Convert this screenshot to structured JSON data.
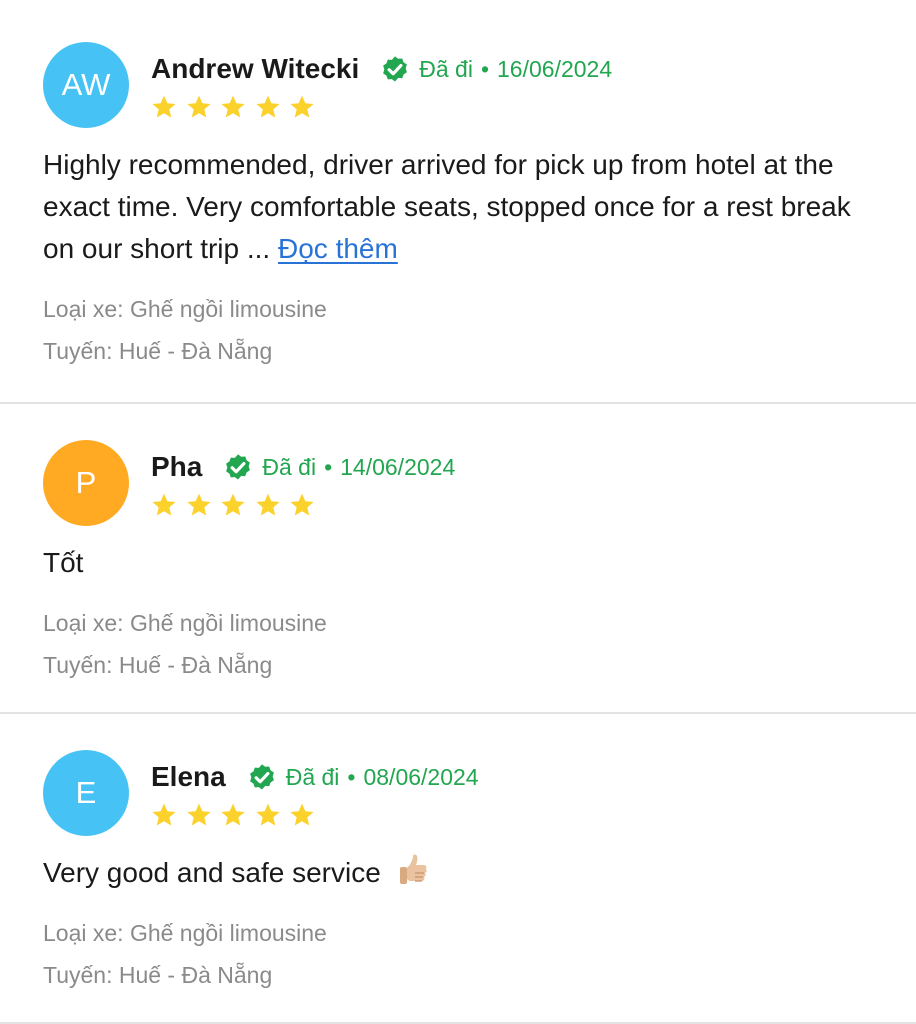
{
  "reviews": [
    {
      "initials": "AW",
      "avatar_color": "#46c3f4",
      "name": "Andrew Witecki",
      "status": "Đã đi",
      "separator": "•",
      "date": "16/06/2024",
      "rating": 5,
      "text": "Highly recommended, driver arrived for pick up from hotel at the exact time. Very comfortable seats, stopped once for a rest break on our short trip ...",
      "read_more": "Đọc thêm",
      "vehicle": "Loại xe: Ghế ngồi limousine",
      "route": "Tuyến: Huế - Đà Nẵng"
    },
    {
      "initials": "P",
      "avatar_color": "#ffaa22",
      "name": "Pha",
      "status": "Đã đi",
      "separator": "•",
      "date": "14/06/2024",
      "rating": 5,
      "text": "Tốt",
      "vehicle": "Loại xe: Ghế ngồi limousine",
      "route": "Tuyến: Huế - Đà Nẵng"
    },
    {
      "initials": "E",
      "avatar_color": "#46c3f4",
      "name": "Elena",
      "status": "Đã đi",
      "separator": "•",
      "date": "08/06/2024",
      "rating": 5,
      "text": "Very good and safe service",
      "emoji": "thumbs-up-icon",
      "vehicle": "Loại xe: Ghế ngồi limousine",
      "route": "Tuyến: Huế - Đà Nẵng"
    }
  ],
  "colors": {
    "verified": "#22a650",
    "star": "#fbd12b",
    "link": "#2a73d6",
    "muted": "#8a8a8a"
  }
}
